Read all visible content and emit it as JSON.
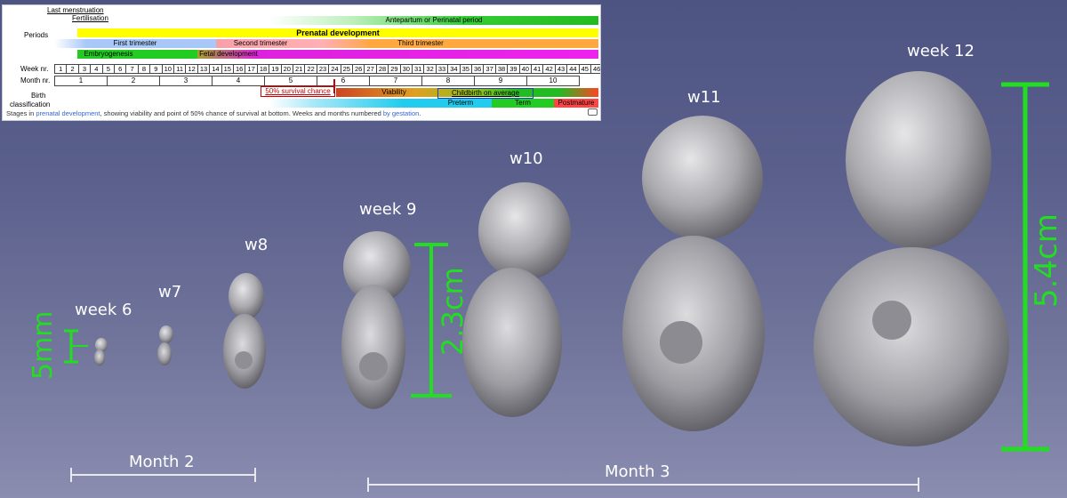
{
  "timeline": {
    "last_menstruation": "Last menstruation",
    "fertilisation": "Fertilisation",
    "periods_label": "Periods",
    "antepartum": "Antepartum or Perinatal period",
    "prenatal": "Prenatal development",
    "trimesters": [
      "First trimester",
      "Second trimester",
      "Third trimester"
    ],
    "embryogenesis": "Embryogenesis",
    "fetal": "Fetal development",
    "week_label": "Week nr.",
    "month_label": "Month nr.",
    "weeks": [
      "1",
      "2",
      "3",
      "4",
      "5",
      "6",
      "7",
      "8",
      "9",
      "10",
      "11",
      "12",
      "13",
      "14",
      "15",
      "16",
      "17",
      "18",
      "19",
      "20",
      "21",
      "22",
      "23",
      "24",
      "25",
      "26",
      "27",
      "28",
      "29",
      "30",
      "31",
      "32",
      "33",
      "34",
      "35",
      "36",
      "37",
      "38",
      "39",
      "40",
      "41",
      "42",
      "43",
      "44",
      "45",
      "46"
    ],
    "months": [
      "1",
      "2",
      "3",
      "4",
      "5",
      "6",
      "7",
      "8",
      "9",
      "10"
    ],
    "birth_label": "Birth",
    "classification_label": "classification",
    "survival": "50% survival chance",
    "viability": "Viability",
    "childbirth": "Childbirth on average",
    "preterm": "Preterm",
    "term": "Term",
    "postmature": "Postmature",
    "caption_pre": "Stages in ",
    "caption_link1": "prenatal development",
    "caption_mid": ", showing viability and point of 50% chance of survival at bottom. Weeks and months numbered ",
    "caption_link2": "by gestation",
    "caption_end": ".",
    "expand_icon": "expand-icon"
  },
  "embryos": {
    "week6": "week 6",
    "w7": "w7",
    "w8": "w8",
    "week9": "week 9",
    "w10": "w10",
    "w11": "w11",
    "week12": "week 12"
  },
  "measurements": {
    "m5mm": "5mm",
    "m23cm": "2.3cm",
    "m54cm": "5.4cm"
  },
  "months_bottom": {
    "month2": "Month 2",
    "month3": "Month 3"
  },
  "colors": {
    "measure_green": "#22dd22",
    "background_top": "#4e5482",
    "background_bottom": "#8a8db0",
    "embryo_grey": "#b8b8bc"
  }
}
